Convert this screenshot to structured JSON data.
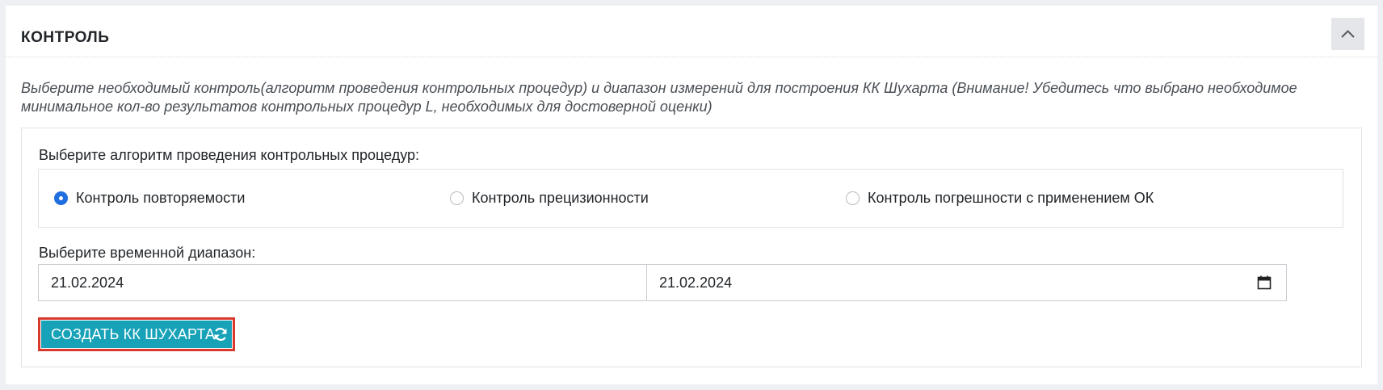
{
  "panel": {
    "title": "КОНТРОЛЬ",
    "collapse_icon": "chevron-up-icon",
    "description": "Выберите необходимый контроль(алгоритм проведения контрольных процедур) и диапазон измерений для построения КК Шухарта (Внимание! Убедитесь что выбрано необходимое минимальное кол-во результатов контрольных процедур L, необходимых для достоверной оценки)"
  },
  "algorithm": {
    "label": "Выберите алгоритм проведения контрольных процедур:",
    "options": [
      {
        "label": "Контроль повторяемости",
        "checked": true
      },
      {
        "label": "Контроль прецизионности",
        "checked": false
      },
      {
        "label": "Контроль погрешности с применением ОК",
        "checked": false
      }
    ]
  },
  "range": {
    "label": "Выберите временной диапазон:",
    "from": "21.02.2024",
    "to": "21.02.2024",
    "calendar_icon": "calendar-icon"
  },
  "create_button": {
    "label": "СОЗДАТЬ КК ШУХАРТА",
    "icon": "refresh-icon"
  },
  "colors": {
    "accent_radio": "#1f6fe0",
    "button_bg": "#17a2b8",
    "highlight_border": "#d9392b"
  }
}
